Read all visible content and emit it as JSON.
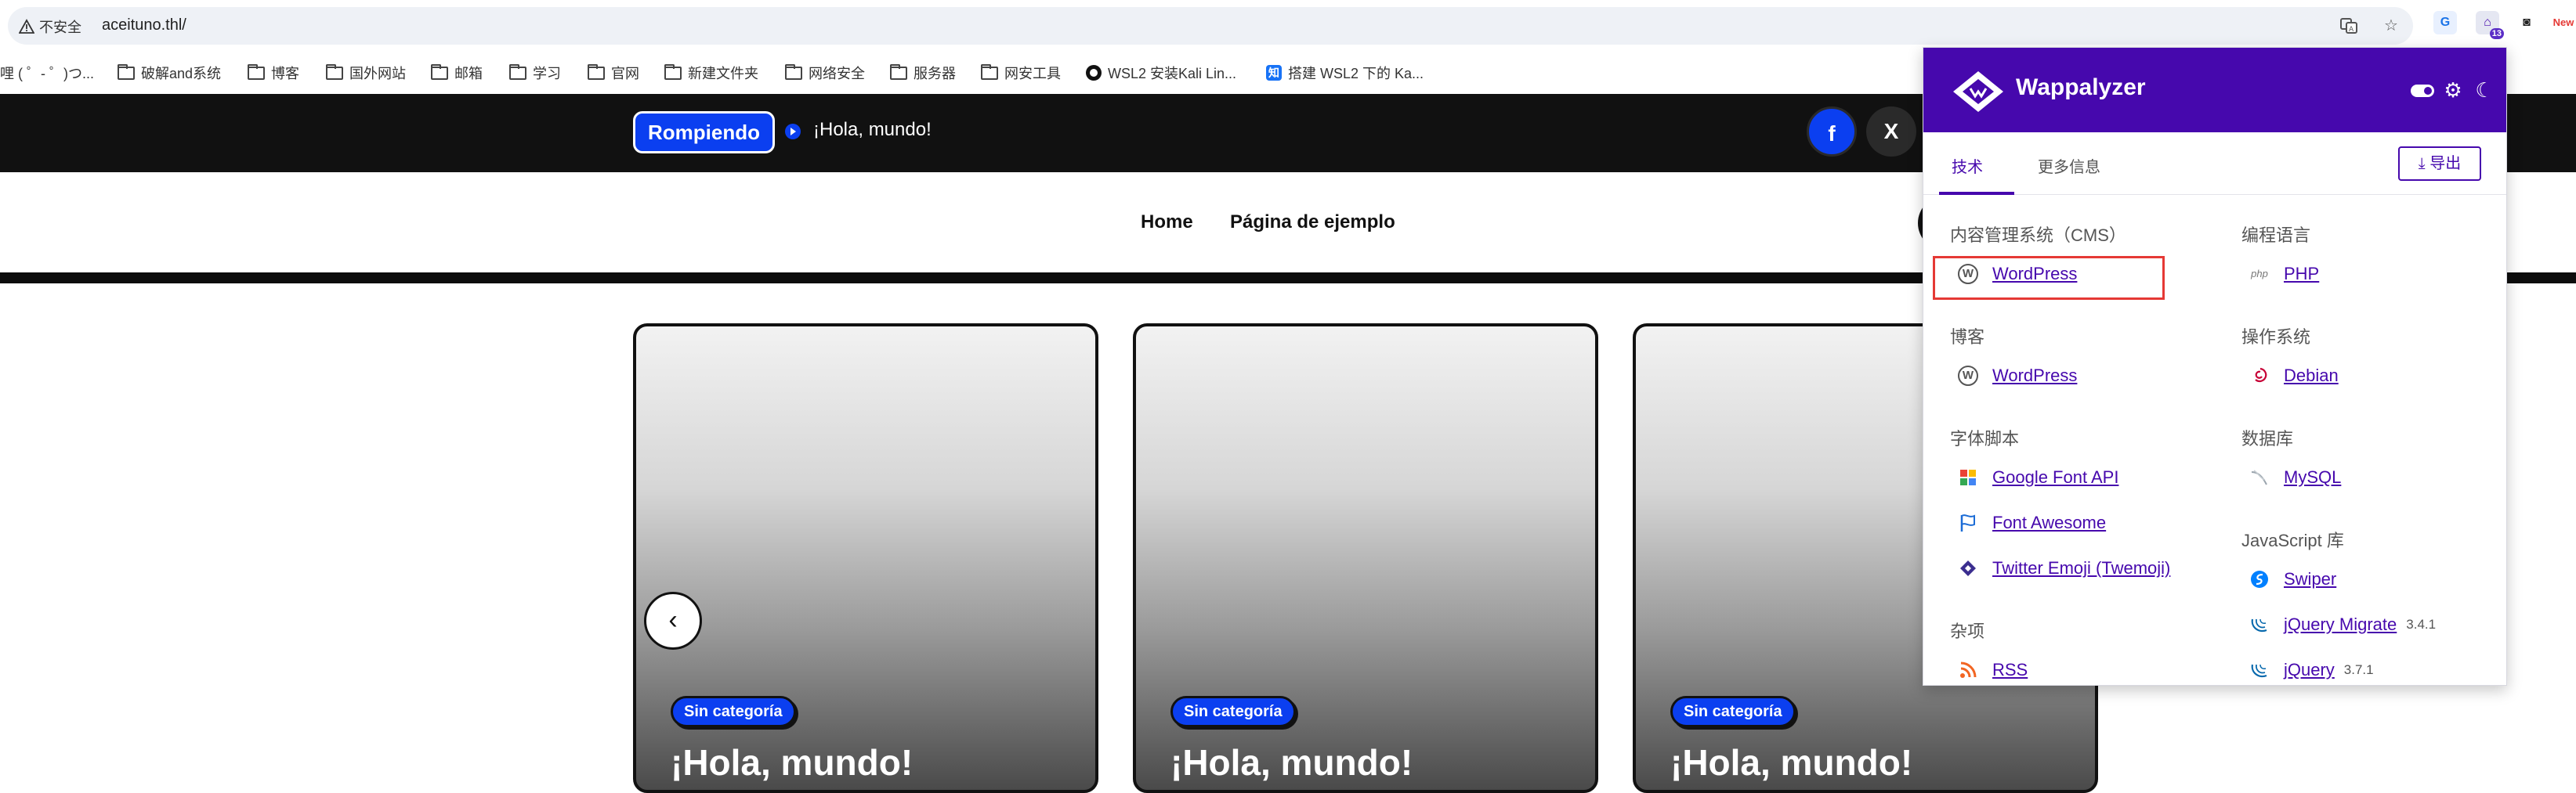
{
  "browser": {
    "security_label": "不安全",
    "url": "aceituno.thl/",
    "ext_badge": "13",
    "ext_new_label": "New"
  },
  "bookmarks": [
    "哩 ( ゜- ゜)つ...",
    "破解and系统",
    "博客",
    "国外网站",
    "邮箱",
    "学习",
    "官网",
    "新建文件夹",
    "网络安全",
    "服务器",
    "网安工具",
    "WSL2 安装Kali Lin...",
    "搭建 WSL2 下的 Ka..."
  ],
  "site": {
    "breaking_label": "Rompiendo",
    "ticker_text": "¡Hola, mundo!",
    "social": [
      "f",
      "X"
    ],
    "nav": [
      "Home",
      "Página de ejemplo"
    ],
    "cards": [
      {
        "category": "Sin categoría",
        "title": "¡Hola, mundo!"
      },
      {
        "category": "Sin categoría",
        "title": "¡Hola, mundo!"
      },
      {
        "category": "Sin categoría",
        "title": "¡Hola, mundo!"
      }
    ]
  },
  "wappalyzer": {
    "title": "Wappalyzer",
    "tabs": [
      "技术",
      "更多信息"
    ],
    "export_label": "导出",
    "left_column": [
      {
        "category": "内容管理系统（CMS）",
        "items": [
          {
            "name": "WordPress",
            "icon": "wordpress-icon"
          }
        ]
      },
      {
        "category": "博客",
        "items": [
          {
            "name": "WordPress",
            "icon": "wordpress-icon"
          }
        ]
      },
      {
        "category": "字体脚本",
        "items": [
          {
            "name": "Google Font API",
            "icon": "google-fonts-icon"
          },
          {
            "name": "Font Awesome",
            "icon": "font-awesome-icon"
          },
          {
            "name": "Twitter Emoji (Twemoji)",
            "icon": "twemoji-icon"
          }
        ]
      },
      {
        "category": "杂项",
        "items": [
          {
            "name": "RSS",
            "icon": "rss-icon"
          }
        ]
      }
    ],
    "right_column": [
      {
        "category": "编程语言",
        "items": [
          {
            "name": "PHP",
            "icon": "php-icon"
          }
        ]
      },
      {
        "category": "操作系统",
        "items": [
          {
            "name": "Debian",
            "icon": "debian-icon"
          }
        ]
      },
      {
        "category": "数据库",
        "items": [
          {
            "name": "MySQL",
            "icon": "mysql-icon"
          }
        ]
      },
      {
        "category": "JavaScript 库",
        "items": [
          {
            "name": "Swiper",
            "icon": "swiper-icon"
          },
          {
            "name": "jQuery Migrate",
            "version": "3.4.1",
            "icon": "jquery-icon"
          },
          {
            "name": "jQuery",
            "version": "3.7.1",
            "icon": "jquery-icon"
          }
        ]
      }
    ],
    "colors": {
      "brand": "#4608ad",
      "highlight": "#e53935"
    }
  }
}
